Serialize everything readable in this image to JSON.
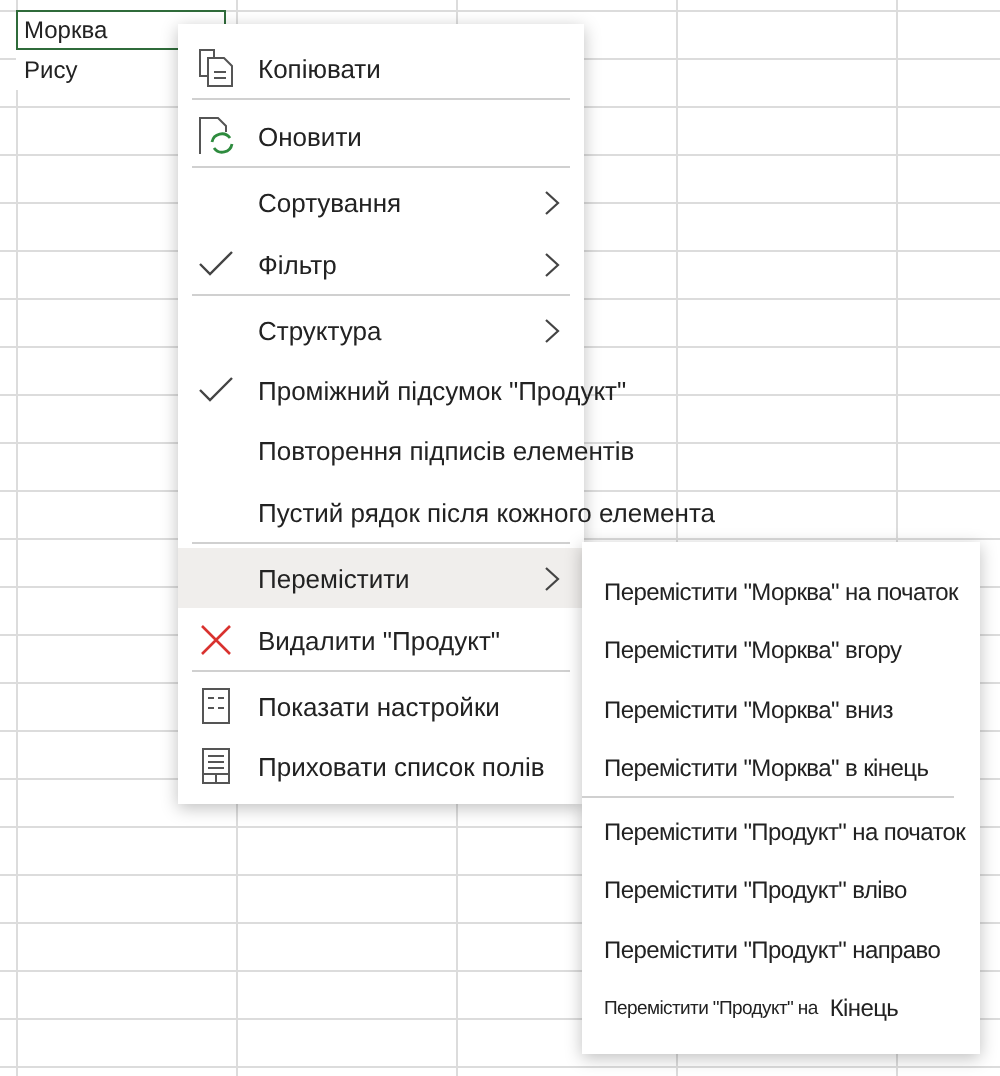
{
  "sheet": {
    "cells": [
      {
        "text": "Морква",
        "selected": true
      },
      {
        "text": "Рису",
        "selected": false
      }
    ]
  },
  "menu": {
    "items": [
      {
        "label": "Копіювати",
        "checked": false,
        "submenu": false,
        "selected": false,
        "separator_after": true
      },
      {
        "label": "Оновити",
        "checked": false,
        "submenu": false,
        "selected": false,
        "separator_after": true
      },
      {
        "label": "Сортування",
        "checked": false,
        "submenu": true,
        "selected": false,
        "separator_after": false
      },
      {
        "label": "Фільтр",
        "checked": true,
        "submenu": true,
        "selected": false,
        "separator_after": true
      },
      {
        "label": "Структура",
        "checked": false,
        "submenu": true,
        "selected": false,
        "separator_after": false
      },
      {
        "label": "Проміжний підсумок \"Продукт\"",
        "checked": true,
        "submenu": false,
        "selected": false,
        "separator_after": false
      },
      {
        "label": "Повторення підписів елементів",
        "checked": false,
        "submenu": false,
        "selected": false,
        "separator_after": false
      },
      {
        "label": "Пустий рядок після кожного елемента",
        "checked": false,
        "submenu": false,
        "selected": false,
        "separator_after": true
      },
      {
        "label": "Перемістити",
        "checked": false,
        "submenu": true,
        "selected": true,
        "separator_after": false
      },
      {
        "label": "Видалити \"Продукт\"",
        "checked": false,
        "submenu": false,
        "selected": false,
        "separator_after": true
      },
      {
        "label": "Показати настройки",
        "checked": false,
        "submenu": false,
        "selected": false,
        "separator_after": false
      },
      {
        "label": "Приховати список полів",
        "checked": false,
        "submenu": false,
        "selected": false,
        "separator_after": false
      }
    ]
  },
  "submenu": {
    "items": [
      {
        "label": "Перемістити \"Морква\" на початок",
        "separator_after": false
      },
      {
        "label": "Перемістити \"Морква\" вгору",
        "separator_after": false
      },
      {
        "label": "Перемістити \"Морква\" вниз",
        "separator_after": false
      },
      {
        "label": "Перемістити \"Морква\" в кінець",
        "separator_after": true
      },
      {
        "label": "Перемістити \"Продукт\" на початок",
        "separator_after": false
      },
      {
        "label": "Перемістити \"Продукт\" вліво",
        "separator_after": false
      },
      {
        "label": "Перемістити \"Продукт\" направо",
        "separator_after": false
      },
      {
        "label": "Перемістити \"Продукт\" на",
        "suffix": "Кінець",
        "separator_after": false
      }
    ]
  }
}
